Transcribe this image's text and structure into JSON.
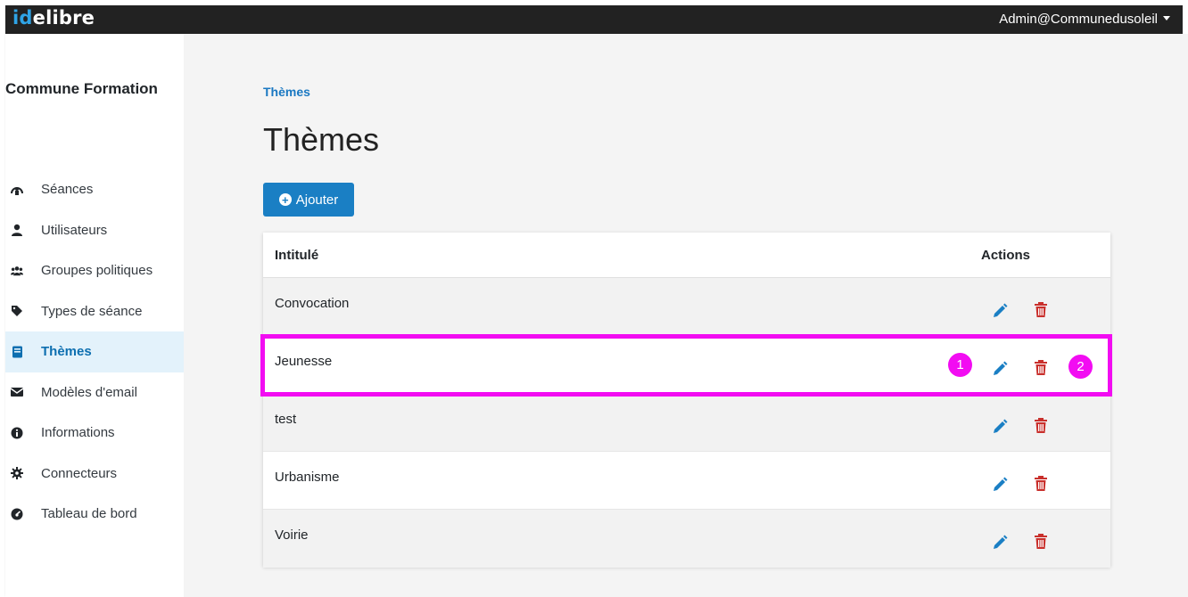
{
  "header": {
    "brand_accent": "id",
    "brand_rest": "elibre",
    "user": "Admin@Communedusoleil"
  },
  "sidebar": {
    "org_name": "Commune Formation",
    "items": [
      {
        "label": "Séances",
        "icon": "podium-icon",
        "active": false
      },
      {
        "label": "Utilisateurs",
        "icon": "user-icon",
        "active": false
      },
      {
        "label": "Groupes politiques",
        "icon": "users-icon",
        "active": false
      },
      {
        "label": "Types de séance",
        "icon": "tag-icon",
        "active": false
      },
      {
        "label": "Thèmes",
        "icon": "book-icon",
        "active": true
      },
      {
        "label": "Modèles d'email",
        "icon": "envelope-icon",
        "active": false
      },
      {
        "label": "Informations",
        "icon": "info-circle-icon",
        "active": false
      },
      {
        "label": "Connecteurs",
        "icon": "gear-icon",
        "active": false
      },
      {
        "label": "Tableau de bord",
        "icon": "dashboard-icon",
        "active": false
      }
    ]
  },
  "main": {
    "breadcrumb": "Thèmes",
    "title": "Thèmes",
    "add_label": "Ajouter",
    "table": {
      "headers": [
        "Intitulé",
        "Actions"
      ],
      "rows": [
        "Convocation",
        "Jeunesse",
        "test",
        "Urbanisme",
        "Voirie"
      ]
    }
  },
  "annotations": {
    "badge_1": "1",
    "badge_2": "2"
  },
  "colors": {
    "primary": "#1a7fc4",
    "danger": "#c9302c",
    "highlight": "#f20cf2",
    "topbar": "#222222"
  }
}
